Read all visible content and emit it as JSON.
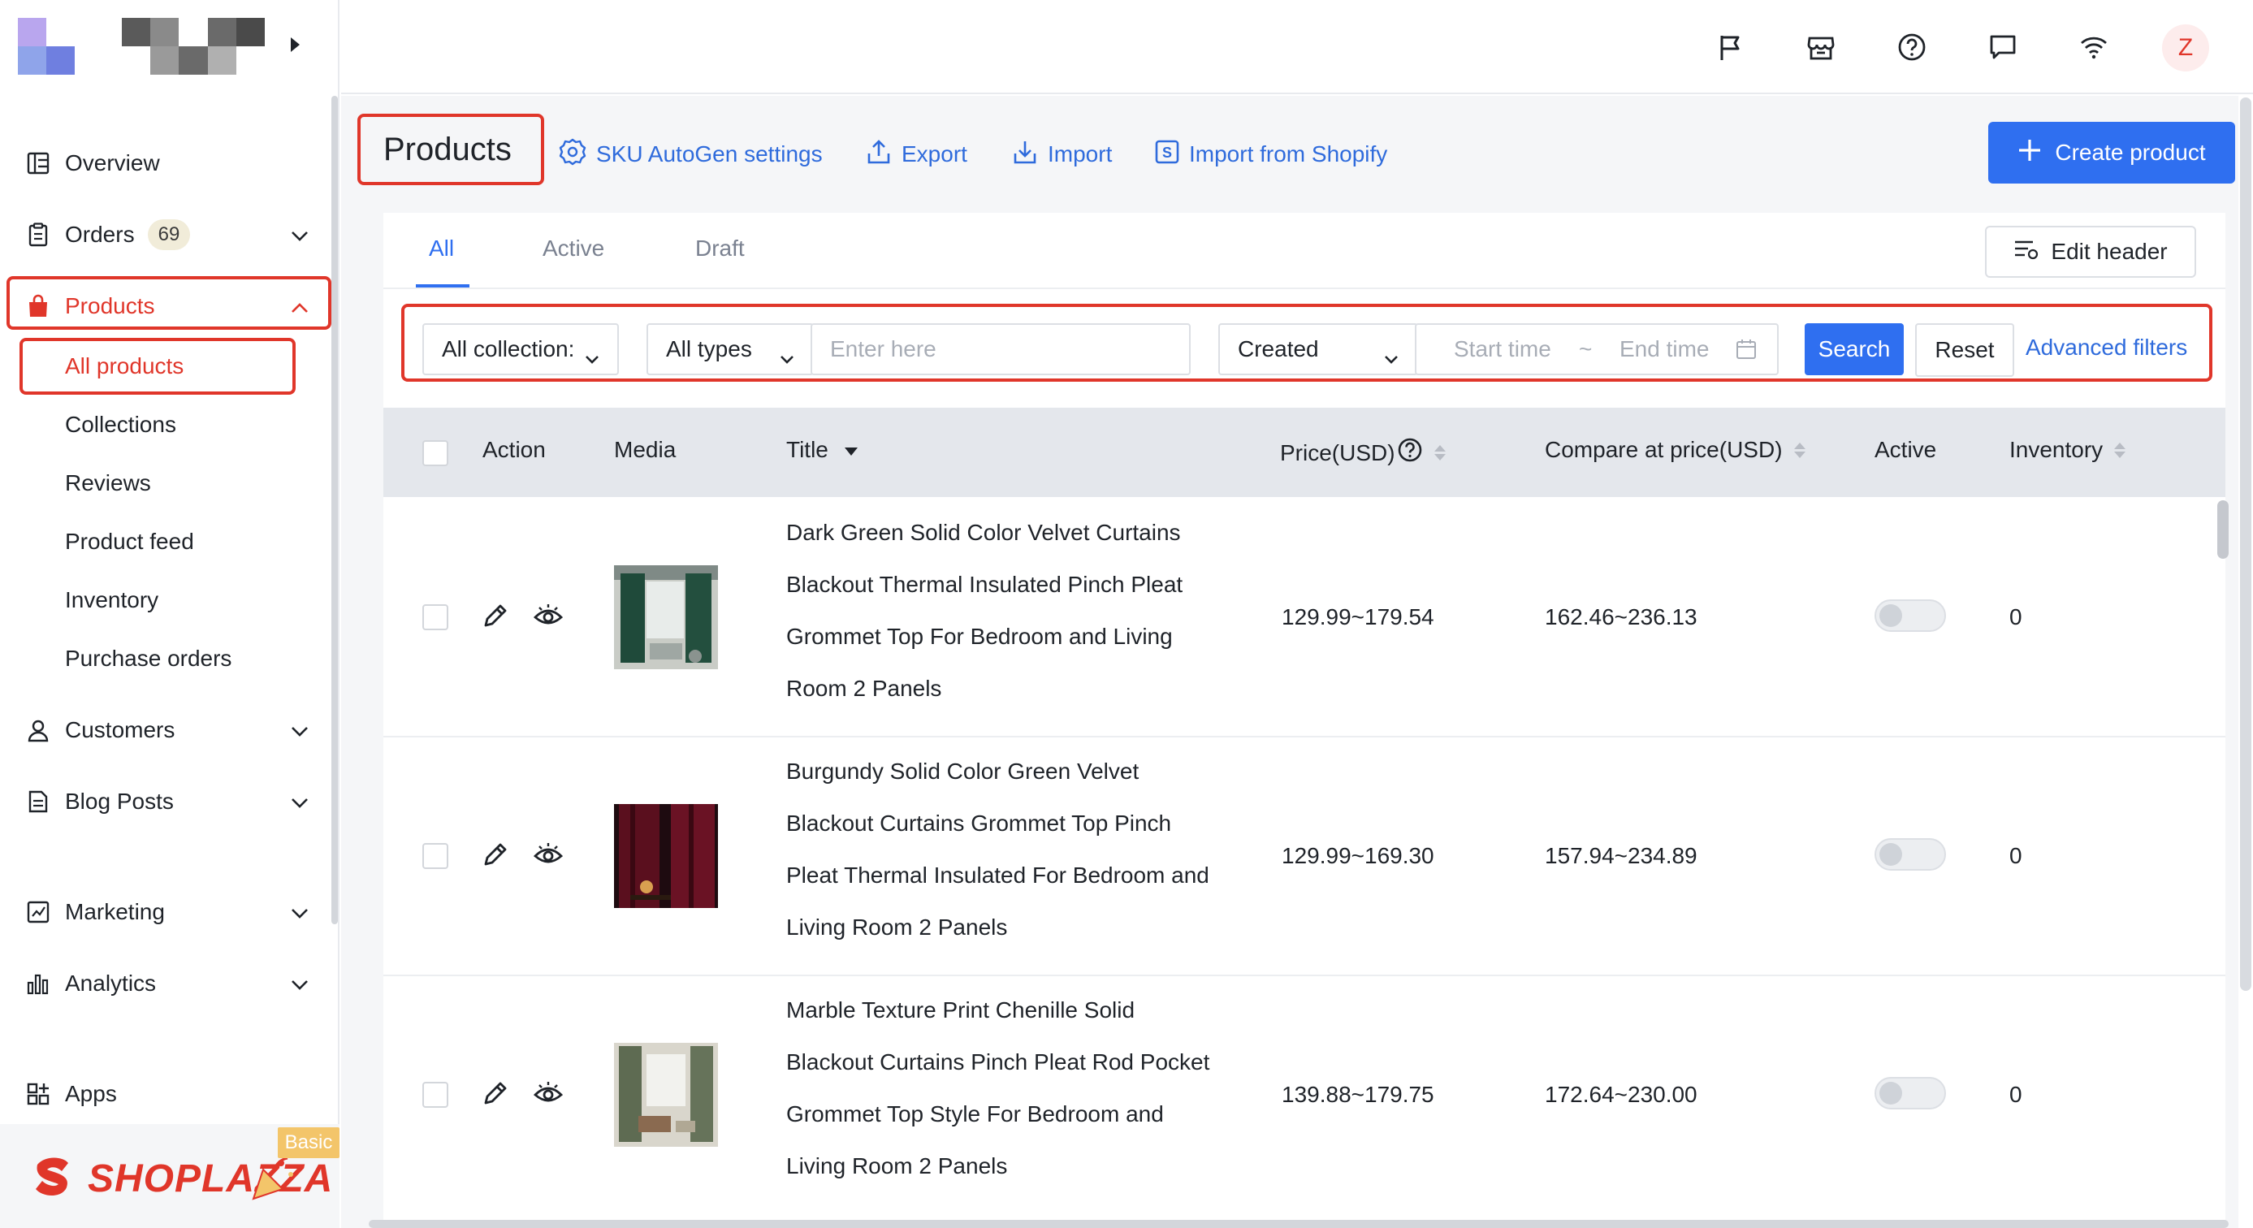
{
  "sidebar": {
    "logo_colors": [
      "#b9a6ee",
      "#8fa4ea",
      "#6f7fe0",
      "#5466d2"
    ],
    "store_name_colors": [
      "#4a4a4a",
      "#8a8a8a",
      "#d0d0d0",
      "#6a6a6a",
      "#3a3a3a",
      "#9a9a9a",
      "#5a5a5a",
      "#b0b0b0",
      "#7a7a7a",
      "#ffffff"
    ],
    "items": [
      {
        "label": "Overview",
        "icon": "overview-icon"
      },
      {
        "label": "Orders",
        "icon": "orders-icon",
        "badge": "69",
        "chevron": "chevron-down-icon"
      },
      {
        "label": "Products",
        "icon": "products-bag-icon",
        "chevron": "chevron-up-icon",
        "active": true
      },
      {
        "label": "Customers",
        "icon": "customers-icon",
        "chevron": "chevron-down-icon"
      },
      {
        "label": "Blog Posts",
        "icon": "blog-icon",
        "chevron": "chevron-down-icon"
      },
      {
        "label": "Marketing",
        "icon": "marketing-icon",
        "chevron": "chevron-down-icon"
      },
      {
        "label": "Analytics",
        "icon": "analytics-icon",
        "chevron": "chevron-down-icon"
      },
      {
        "label": "Apps",
        "icon": "apps-icon"
      }
    ],
    "product_subitems": [
      "All products",
      "Collections",
      "Reviews",
      "Product feed",
      "Inventory",
      "Purchase orders"
    ],
    "brand": "SHOPLAZZA",
    "plan_tag": "Basic"
  },
  "topbar": {
    "icons": [
      "flag-icon",
      "store-icon",
      "help-icon",
      "chat-icon",
      "wifi-icon"
    ],
    "avatar_letter": "Z"
  },
  "header": {
    "title": "Products",
    "links": [
      "SKU AutoGen settings",
      "Export",
      "Import",
      "Import from Shopify"
    ],
    "create_button": "Create product"
  },
  "tabs": [
    "All",
    "Active",
    "Draft"
  ],
  "edit_header": "Edit header",
  "filters": {
    "collection": "All collection:",
    "type": "All types",
    "search_placeholder": "Enter here",
    "date_field": "Created",
    "start_placeholder": "Start time",
    "range_sep": "~",
    "end_placeholder": "End time",
    "search_button": "Search",
    "reset_button": "Reset",
    "advanced": "Advanced filters"
  },
  "table": {
    "columns": [
      "Action",
      "Media",
      "Title",
      "Price(USD)",
      "Compare at price(USD)",
      "Active",
      "Inventory"
    ],
    "rows": [
      {
        "title_lines": [
          "Dark Green Solid Color Velvet Curtains",
          "Blackout Thermal Insulated Pinch Pleat",
          "Grommet Top For Bedroom and Living",
          "Room 2 Panels"
        ],
        "price": "129.99~179.54",
        "compare": "162.46~236.13",
        "inventory": "0",
        "active": false
      },
      {
        "title_lines": [
          "Burgundy Solid Color Green Velvet",
          "Blackout Curtains Grommet Top Pinch",
          "Pleat Thermal Insulated For Bedroom and",
          "Living Room 2 Panels"
        ],
        "price": "129.99~169.30",
        "compare": "157.94~234.89",
        "inventory": "0",
        "active": false
      },
      {
        "title_lines": [
          "Marble Texture Print Chenille Solid",
          "Blackout Curtains Pinch Pleat Rod Pocket",
          "Grommet Top Style For Bedroom and",
          "Living Room 2 Panels"
        ],
        "price": "139.88~179.75",
        "compare": "172.64~230.00",
        "inventory": "0",
        "active": false
      }
    ]
  },
  "colors": {
    "accent": "#2f6ff0",
    "highlight": "#e0362a"
  }
}
